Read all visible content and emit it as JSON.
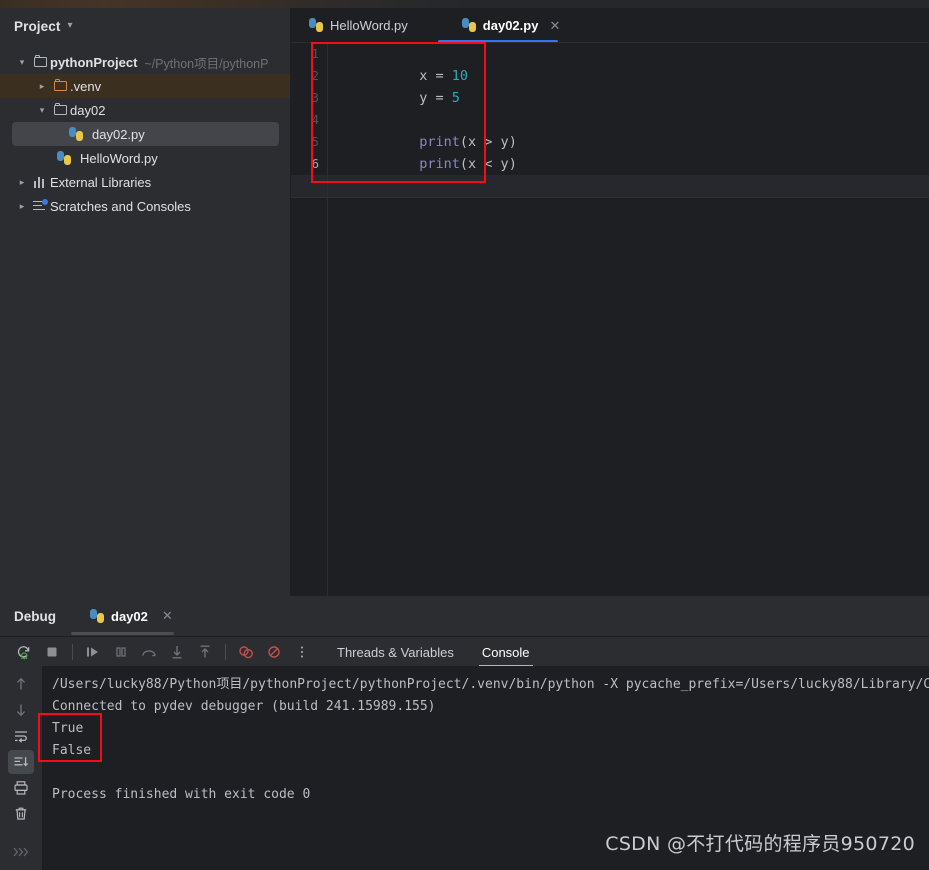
{
  "sidebar": {
    "header": {
      "title": "Project",
      "chevron_icon": "chevron-down-icon"
    },
    "items": [
      {
        "label": "pythonProject",
        "path": "~/Python项目/pythonP",
        "icon": "folder-icon",
        "arrow": "down",
        "indent": 0,
        "bold": true,
        "state": "normal"
      },
      {
        "label": ".venv",
        "path": "",
        "icon": "folder-orange-icon",
        "arrow": "right",
        "indent": 1,
        "bold": false,
        "state": "venv-highlight"
      },
      {
        "label": "day02",
        "path": "",
        "icon": "folder-icon",
        "arrow": "down",
        "indent": 1,
        "bold": false,
        "state": "normal"
      },
      {
        "label": "day02.py",
        "path": "",
        "icon": "python-file-icon",
        "arrow": "blank",
        "indent": 2,
        "bold": false,
        "state": "selected"
      },
      {
        "label": "HelloWord.py",
        "path": "",
        "icon": "python-file-icon",
        "arrow": "blank",
        "indent": 2,
        "bold": false,
        "state": "normal"
      },
      {
        "label": "External Libraries",
        "path": "",
        "icon": "libraries-icon",
        "arrow": "right",
        "indent": 0,
        "bold": false,
        "state": "normal"
      },
      {
        "label": "Scratches and Consoles",
        "path": "",
        "icon": "scratches-icon",
        "arrow": "right",
        "indent": 0,
        "bold": false,
        "state": "normal"
      }
    ]
  },
  "editor": {
    "tabs": [
      {
        "label": "HelloWord.py",
        "icon": "python-file-icon",
        "active": false,
        "closable": false
      },
      {
        "label": "day02.py",
        "icon": "python-file-icon",
        "active": true,
        "closable": true,
        "close_icon": "close-icon"
      }
    ],
    "line_numbers": [
      "1",
      "2",
      "3",
      "4",
      "5",
      "6"
    ],
    "lines": [
      {
        "segments": [
          {
            "t": "x = ",
            "c": "plain"
          },
          {
            "t": "10",
            "c": "number"
          }
        ]
      },
      {
        "segments": [
          {
            "t": "y = ",
            "c": "plain"
          },
          {
            "t": "5",
            "c": "number"
          }
        ]
      },
      {
        "segments": [
          {
            "t": "",
            "c": "plain"
          }
        ]
      },
      {
        "segments": [
          {
            "t": "print",
            "c": "function"
          },
          {
            "t": "(x > y)",
            "c": "plain"
          }
        ]
      },
      {
        "segments": [
          {
            "t": "print",
            "c": "function"
          },
          {
            "t": "(x < y)",
            "c": "plain"
          }
        ]
      },
      {
        "segments": [
          {
            "t": "",
            "c": "plain"
          }
        ]
      }
    ]
  },
  "debug": {
    "title": "Debug",
    "session_tab": {
      "label": "day02",
      "icon": "python-file-icon",
      "close_icon": "close-icon"
    },
    "toolbar": [
      {
        "name": "rerun-icon",
        "label": "Rerun"
      },
      {
        "name": "stop-icon",
        "label": "Stop"
      },
      {
        "name": "resume-icon",
        "label": "Resume Program"
      },
      {
        "name": "pause-icon",
        "label": "Pause Program"
      },
      {
        "name": "step-over-icon",
        "label": "Step Over"
      },
      {
        "name": "step-into-icon",
        "label": "Step Into"
      },
      {
        "name": "step-out-icon",
        "label": "Step Out"
      },
      {
        "name": "view-breakpoints-icon",
        "label": "View Breakpoints"
      },
      {
        "name": "mute-breakpoints-icon",
        "label": "Mute Breakpoints"
      },
      {
        "name": "more-options-icon",
        "label": "More"
      }
    ],
    "subtabs": [
      {
        "label": "Threads & Variables",
        "active": false
      },
      {
        "label": "Console",
        "active": true
      }
    ],
    "rail": [
      {
        "name": "scroll-up-icon",
        "label": "Up",
        "active": false
      },
      {
        "name": "scroll-down-icon",
        "label": "Down",
        "active": false
      },
      {
        "name": "soft-wrap-icon",
        "label": "Soft-Wrap",
        "active": false
      },
      {
        "name": "scroll-to-end-icon",
        "label": "Scroll to End",
        "active": true
      },
      {
        "name": "print-icon",
        "label": "Print",
        "active": false
      },
      {
        "name": "clear-all-icon",
        "label": "Clear All",
        "active": false
      },
      {
        "name": "expand-more-icon",
        "label": "More",
        "active": false
      }
    ],
    "console_lines": [
      "/Users/lucky88/Python项目/pythonProject/pythonProject/.venv/bin/python -X pycache_prefix=/Users/lucky88/Library/C",
      "Connected to pydev debugger (build 241.15989.155)",
      "True",
      "False",
      "",
      "Process finished with exit code 0"
    ]
  },
  "annotations": {
    "editor_box": {
      "name": "editor-highlight-box",
      "color": "#f50c18"
    },
    "console_box": {
      "name": "console-output-highlight-box",
      "color": "#f50c18"
    }
  },
  "watermark": {
    "text": "CSDN @不打代码的程序员950720"
  },
  "colors": {
    "editor_bg": "#1e1f22",
    "sidebar_bg": "#2b2d30",
    "accent_blue": "#3574f0",
    "annotation_red": "#f50c18",
    "number_cyan": "#2aacb8",
    "function_purple": "#8888c6"
  }
}
